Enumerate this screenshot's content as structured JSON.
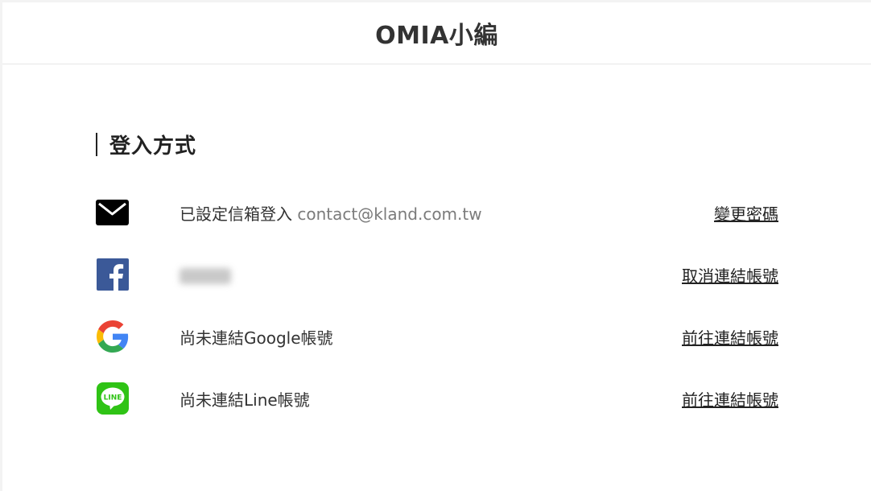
{
  "header": {
    "title": "OMIA小編"
  },
  "section": {
    "title": "登入方式"
  },
  "methods": [
    {
      "icon": "mail-icon",
      "label": "已設定信箱登入",
      "email": "contact@kland.com.tw",
      "action": "變更密碼"
    },
    {
      "icon": "facebook-icon",
      "label": "",
      "action": "取消連結帳號"
    },
    {
      "icon": "google-icon",
      "label": "尚未連結Google帳號",
      "action": "前往連結帳號"
    },
    {
      "icon": "line-icon",
      "label": "尚未連結Line帳號",
      "action": "前往連結帳號",
      "icon_text": "LINE"
    }
  ],
  "colors": {
    "facebook": "#3b5998",
    "line": "#2fc315",
    "google_blue": "#4285F4",
    "google_red": "#EA4335",
    "google_yellow": "#FBBC05",
    "google_green": "#34A853"
  }
}
